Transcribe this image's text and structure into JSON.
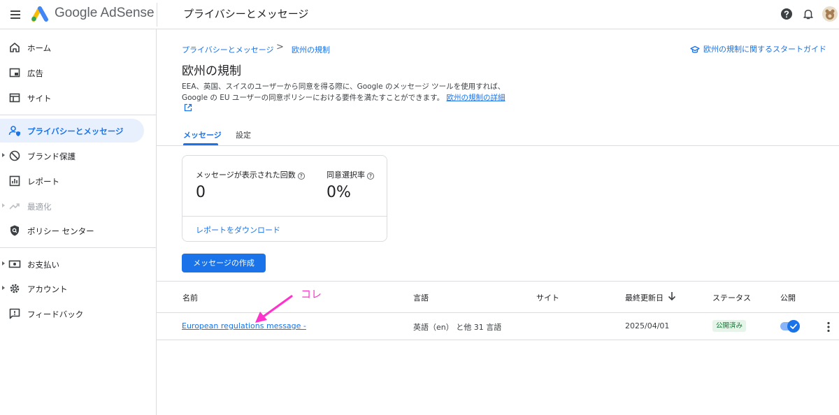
{
  "header": {
    "brand": "Google AdSense",
    "page_title": "プライバシーとメッセージ"
  },
  "sidebar": {
    "items": [
      {
        "label": "ホーム"
      },
      {
        "label": "広告"
      },
      {
        "label": "サイト"
      },
      {
        "label": "プライバシーとメッセージ"
      },
      {
        "label": "ブランド保護"
      },
      {
        "label": "レポート"
      },
      {
        "label": "最適化"
      },
      {
        "label": "ポリシー センター"
      },
      {
        "label": "お支払い"
      },
      {
        "label": "アカウント"
      },
      {
        "label": "フィードバック"
      }
    ]
  },
  "breadcrumb": {
    "parent": "プライバシーとメッセージ",
    "separator": ">",
    "current": "欧州の規制"
  },
  "guide_link": "欧州の規制に関するスタートガイド",
  "main": {
    "title": "欧州の規制",
    "description_line1": "EEA、英国、スイスのユーザーから同意を得る際に、Google のメッセージ ツールを使用すれば、",
    "description_line2": "Google の EU ユーザーの同意ポリシーにおける要件を満たすことができます。",
    "details_link": "欧州の規制の詳細"
  },
  "tabs": [
    {
      "label": "メッセージ"
    },
    {
      "label": "設定"
    }
  ],
  "stats": {
    "impressions_label": "メッセージが表示された回数",
    "impressions_value": "0",
    "consent_rate_label": "同意選択率",
    "consent_rate_value": "0%",
    "help_glyph": "?",
    "download_link": "レポートをダウンロード"
  },
  "create_button": "メッセージの作成",
  "table": {
    "columns": [
      "名前",
      "言語",
      "サイト",
      "最終更新日",
      "ステータス",
      "公開"
    ],
    "rows": [
      {
        "name": "European regulations message -",
        "language": "英語（en） と他 31 言語",
        "site": "",
        "updated": "2025/04/01",
        "status": "公開済み",
        "published": true
      }
    ]
  },
  "annotation": {
    "text": "コレ",
    "color": "#ff33cc"
  },
  "colors": {
    "accent": "#1a73e8",
    "active_bg": "#e8f0fe",
    "badge_bg": "#e6f4ea",
    "badge_text": "#137333"
  },
  "icons": {
    "menu": "menu-icon",
    "help": "help-icon",
    "bell": "bell-icon",
    "sort": "arrow-down-icon",
    "more": "more-vert-icon"
  }
}
